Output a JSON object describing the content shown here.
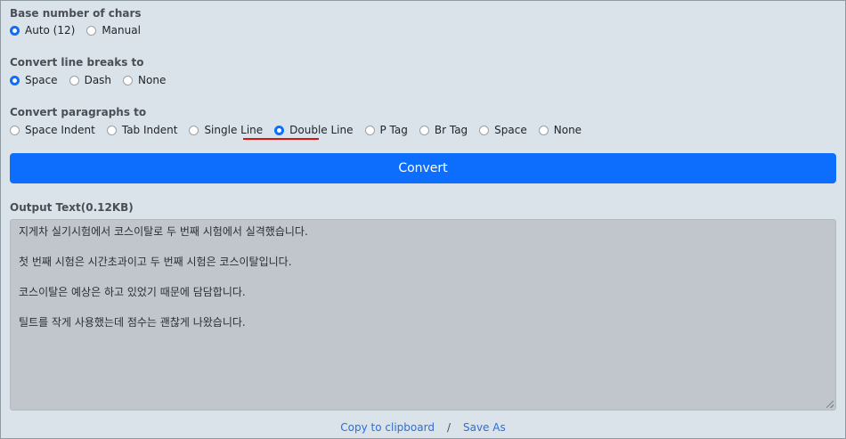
{
  "base_chars": {
    "label": "Base number of chars",
    "options": [
      {
        "label": "Auto (12)",
        "checked": true
      },
      {
        "label": "Manual",
        "checked": false
      }
    ]
  },
  "line_breaks": {
    "label": "Convert line breaks to",
    "options": [
      {
        "label": "Space",
        "checked": true
      },
      {
        "label": "Dash",
        "checked": false
      },
      {
        "label": "None",
        "checked": false
      }
    ]
  },
  "paragraphs": {
    "label": "Convert paragraphs to",
    "options": [
      {
        "label": "Space Indent",
        "checked": false
      },
      {
        "label": "Tab Indent",
        "checked": false
      },
      {
        "label": "Single Line",
        "checked": false
      },
      {
        "label": "Double Line",
        "checked": true
      },
      {
        "label": "P Tag",
        "checked": false
      },
      {
        "label": "Br Tag",
        "checked": false
      },
      {
        "label": "Space",
        "checked": false
      },
      {
        "label": "None",
        "checked": false
      }
    ]
  },
  "convert_label": "Convert",
  "output": {
    "label": "Output Text(0.12KB)",
    "lines": [
      "지게차 실기시험에서 코스이탈로 두 번째 시험에서 실격했습니다.",
      "첫 번째 시험은 시간초과이고 두 번째 시험은 코스이탈입니다.",
      "코스이탈은 예상은 하고 있었기 때문에 담담합니다.",
      "틸트를 작게 사용했는데 점수는 괜찮게 나왔습니다."
    ]
  },
  "footer": {
    "copy_label": "Copy to clipboard",
    "separator": "/",
    "save_label": "Save As"
  },
  "colors": {
    "background": "#dae3ea",
    "accent": "#0d6efd",
    "highlight_underline": "#e01010",
    "link": "#2c6fd6"
  }
}
